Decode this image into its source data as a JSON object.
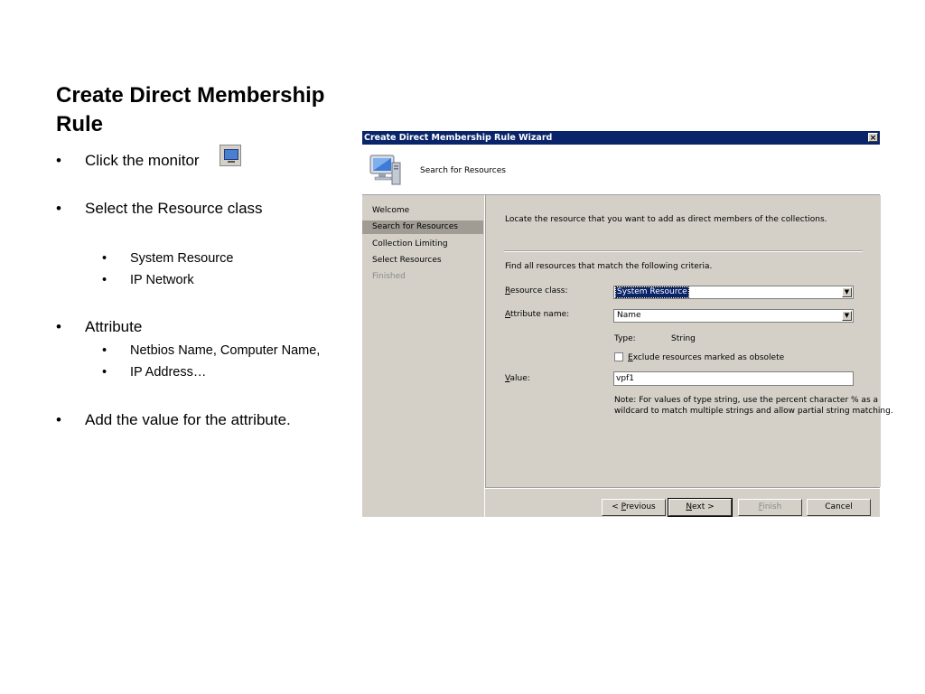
{
  "slide": {
    "title": "Create Direct Membership Rule",
    "bullets": {
      "click_monitor": "Click the monitor",
      "select_class": "Select the Resource class",
      "class_options": [
        "System Resource",
        "IP Network"
      ],
      "attribute": "Attribute",
      "attribute_options": [
        "Netbios Name, Computer Name,",
        "IP Address…"
      ],
      "add_value": "Add the value for the attribute."
    },
    "bullet_char": "•"
  },
  "wizard": {
    "title": "Create Direct Membership Rule Wizard",
    "close_glyph": "×",
    "header_title": "Search for Resources",
    "steps": [
      {
        "label": "Welcome",
        "state": "normal"
      },
      {
        "label": "Search for Resources",
        "state": "active"
      },
      {
        "label": "Collection Limiting",
        "state": "normal"
      },
      {
        "label": "Select Resources",
        "state": "normal"
      },
      {
        "label": "Finished",
        "state": "disabled"
      }
    ],
    "intro": "Locate the resource that you want to add as direct members of the collections.",
    "criteria": "Find all resources that match the following criteria.",
    "resource_class_label_key": "R",
    "resource_class_label_rest": "esource class:",
    "resource_class_value": "System Resource",
    "attribute_label_key": "A",
    "attribute_label_rest": "ttribute name:",
    "attribute_value": "Name",
    "type_label": "Type:",
    "type_value": "String",
    "exclude_key": "E",
    "exclude_rest": "xclude resources marked as obsolete",
    "exclude_checked": false,
    "value_label_key": "V",
    "value_label_rest": "alue:",
    "value_input": "vpf1",
    "note": "Note: For values of type string, use the percent character % as a",
    "note_line2": "wildcard to match multiple strings and allow partial string matching.",
    "buttons": {
      "previous_pre": "< ",
      "previous_key": "P",
      "previous_rest": "revious",
      "next_key": "N",
      "next_rest": "ext >",
      "finish_key": "F",
      "finish_rest": "inish",
      "cancel": "Cancel"
    },
    "dropdown_arrow": "▼"
  },
  "colors": {
    "titlebar": "#0a246a",
    "dialog_face": "#d4d0c8",
    "active_step": "#a09c94"
  }
}
